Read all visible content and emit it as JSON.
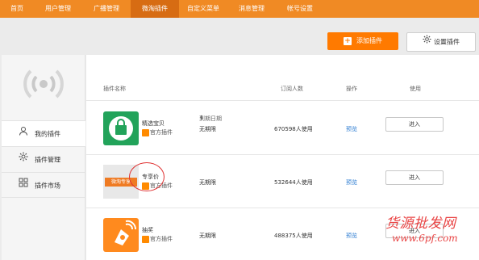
{
  "topnav": {
    "items": [
      {
        "label": "首页"
      },
      {
        "label": "用户管理"
      },
      {
        "label": "广播管理"
      },
      {
        "label": "微淘插件"
      },
      {
        "label": "自定义菜单"
      },
      {
        "label": "消息管理"
      },
      {
        "label": "帐号设置"
      }
    ],
    "active_index": 3
  },
  "toolbar": {
    "add_label": "添加插件",
    "settings_label": "设置插件"
  },
  "sidebar": {
    "items": [
      {
        "label": "我的插件",
        "icon": "user-icon"
      },
      {
        "label": "插件管理",
        "icon": "gear-icon"
      },
      {
        "label": "插件市场",
        "icon": "grid-icon"
      }
    ]
  },
  "table": {
    "headers": {
      "name": "插件名称",
      "expire": "到期日期",
      "subscribers": "订阅人数",
      "operation": "操作",
      "use": "使用"
    },
    "rows": [
      {
        "name": "精选宝贝",
        "official": "官方插件",
        "expire": "无期限",
        "subscribers": "670598人使用",
        "preview": "预览",
        "enter": "进入",
        "thumb_color": "#22a35a"
      },
      {
        "name": "专享价",
        "official": "官方插件",
        "expire": "无期限",
        "subscribers": "532644人使用",
        "preview": "预览",
        "enter": "进入",
        "thumb_color": "#e8e8e8",
        "thumb_badge": "微淘专享"
      },
      {
        "name": "抽奖",
        "official": "官方插件",
        "expire": "无期限",
        "subscribers": "488375人使用",
        "preview": "预览",
        "enter": "进入",
        "thumb_color": "#ff8a1e"
      }
    ]
  },
  "watermark": {
    "line1": "货源批发网",
    "line2": "www.6pf.com"
  },
  "colors": {
    "nav_bg": "#f08a24",
    "nav_active": "#d76c13",
    "accent": "#ff7a00",
    "link": "#2b7bd1"
  }
}
